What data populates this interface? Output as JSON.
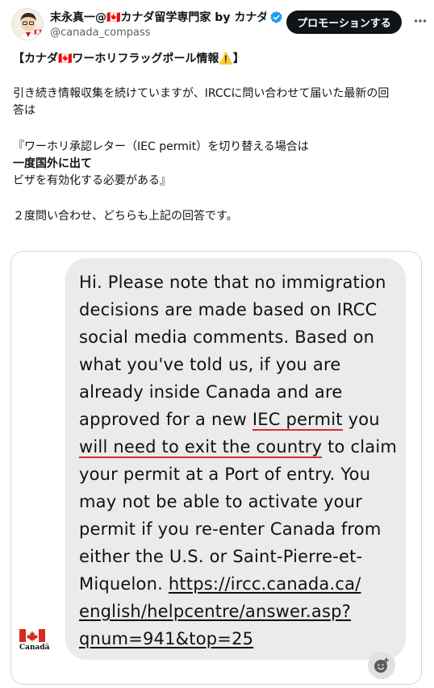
{
  "header": {
    "name": "末永真一@🇨🇦カナダ留学専門家 by カナダ…",
    "handle": "@canada_compass",
    "promote_label": "プロモーションする",
    "more_label": "···"
  },
  "post": {
    "line1": "【カナダ🇨🇦ワーホリフラッグポール情報⚠️】",
    "line2": "引き続き情報収集を続けていますが、IRCCに問い合わせて届いた最新の回",
    "line3": "答は",
    "line4": "『ワーホリ承認レター（IEC permit）を切り替える場合は",
    "line5": "一度国外に出て",
    "line6": "ビザを有効化する必要がある』",
    "line7": "２度問い合わせ、どちらも上記の回答です。"
  },
  "media": {
    "lines": [
      "Hi. Please note that no immigration",
      "decisions are made based on IRCC",
      "social media comments. Based on",
      "what you've told us, if you are",
      "already inside Canada and are",
      "approved for a new ",
      "IEC permit",
      " you",
      "will need to exit the country",
      " to claim",
      "your permit at a Port of entry. You",
      "may not be able to activate your",
      "permit if you re-enter Canada from",
      "either the U.S. or Saint-Pierre-et-",
      "Miquelon. ",
      "https://ircc.canada.ca/",
      "english/helpcentre/answer.asp?",
      "qnum=941&top=25"
    ],
    "logo_text": "Canadä"
  },
  "colors": {
    "text": "#0f1419",
    "secondary": "#536471",
    "verified_blue": "#1d9bf0",
    "bubble": "#ebebeb",
    "highlight_red": "#d32f2f",
    "canada_red": "#d52b1e"
  }
}
